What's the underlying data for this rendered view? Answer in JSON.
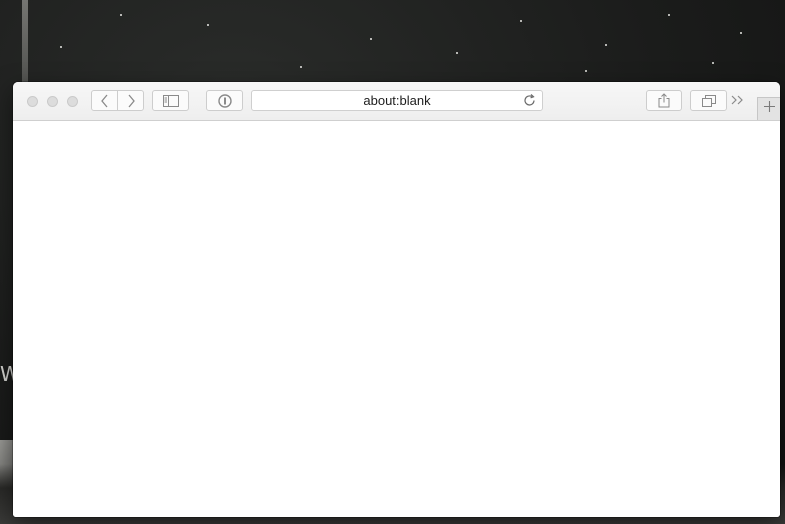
{
  "browser": {
    "address_bar": {
      "url": "about:blank"
    },
    "toolbar": {
      "traffic_lights": [
        "close",
        "minimize",
        "zoom"
      ],
      "buttons": [
        {
          "name": "back",
          "icon": "chevron-left-icon"
        },
        {
          "name": "forward",
          "icon": "chevron-right-icon"
        },
        {
          "name": "sidebar",
          "icon": "sidebar-icon"
        },
        {
          "name": "password-manager",
          "icon": "1password-icon"
        },
        {
          "name": "reload",
          "icon": "reload-icon"
        },
        {
          "name": "share",
          "icon": "share-icon"
        },
        {
          "name": "tabs-overview",
          "icon": "tabs-overview-icon"
        },
        {
          "name": "overflow",
          "icon": "double-chevron-right-icon"
        },
        {
          "name": "new-tab",
          "icon": "plus-icon"
        }
      ]
    },
    "content": {
      "page": "blank"
    }
  },
  "wallpaper": {
    "visible_text": "W",
    "colors": {
      "sky": "#1b1c1b",
      "stars": "#e8e8e4"
    }
  }
}
